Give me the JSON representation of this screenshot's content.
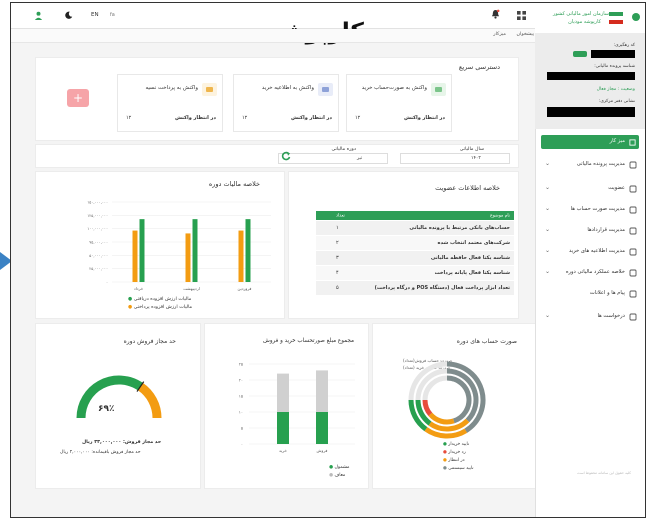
{
  "title_overlay": "کارپوشه",
  "header": {
    "lang": "EN",
    "lang_alt": "fa",
    "org_name": "سازمان امور مالیاتی کشور",
    "app_name": "کارپوشه مودیان"
  },
  "breadcrumb": {
    "item1": "پیشخوان",
    "item2": "میزکار"
  },
  "user": {
    "id_label": "کد رهگیری:",
    "id_value": "--",
    "file_label": "شناسه پرونده مالیاتی:",
    "status_label": "وضعیت : مجاز فعال",
    "office_label": "نشانی دفتر مرکزی:"
  },
  "sidebar": {
    "active": "میز کار",
    "items": [
      {
        "label": "مدیریت پرونده مالیاتی",
        "expand": true
      },
      {
        "label": "عضویت",
        "expand": true
      },
      {
        "label": "مدیریت صورت حساب ها",
        "expand": true
      },
      {
        "label": "مدیریت قراردادها",
        "expand": true
      },
      {
        "label": "مدیریت اطلاعیه های خرید",
        "expand": true
      },
      {
        "label": "خلاصه عملکرد مالیاتی دوره",
        "expand": true
      },
      {
        "label": "پیام ها و اعلانات",
        "expand": false
      },
      {
        "label": "درخواست ها",
        "expand": true
      }
    ],
    "footer": "کلیه حقوق این سامانه محفوظ است"
  },
  "quick_access": {
    "title": "دسترسی سریع",
    "cards": [
      {
        "title": "واکنش به صورت‌حساب خرید",
        "status": "در انتظار واکنش",
        "count": "۱۲",
        "accent": "#e7f5e9",
        "icon": "#7bc58a"
      },
      {
        "title": "واکنش به اطلاعیه خرید",
        "status": "در انتظار واکنش",
        "count": "۱۲",
        "accent": "#e8ecf8",
        "icon": "#8ea2d8"
      },
      {
        "title": "واکنش به پرداخت نسیه",
        "status": "در انتظار واکنش",
        "count": "۱۲",
        "accent": "#fdf3df",
        "icon": "#efb64d"
      }
    ],
    "add_button": "+"
  },
  "filters": {
    "year_label": "سال مالیاتی",
    "year_value": "۱۴۰۲",
    "period_label": "دوره مالیاتی",
    "period_value": "تیر"
  },
  "membership": {
    "title": "خلاصه اطلاعات عضویت",
    "col_name": "نام موضوع",
    "col_count": "تعداد",
    "rows": [
      {
        "name": "حساب‌های بانکی مرتبط با پرونده مالیاتی",
        "count": "۱"
      },
      {
        "name": "شرکت‌های معتمد انتخاب شده",
        "count": "۲"
      },
      {
        "name": "شناسه یکتا فعال حافظه مالیاتی",
        "count": "۳"
      },
      {
        "name": "شناسه یکتا فعال پایانه پرداخت",
        "count": "۴"
      },
      {
        "name": "تعداد ابزار پرداخت فعال (دستگاه POS و درگاه پرداخت)",
        "count": "۵"
      }
    ]
  },
  "tax_summary": {
    "title": "خلاصه مالیات دوره",
    "legend": [
      "مالیات ارزش افزوده دریافتی",
      "مالیات ارزش افزوده پرداختی"
    ],
    "colors": {
      "received": "#27a04f",
      "paid": "#f39c12"
    }
  },
  "sales_limit": {
    "title": "حد مجاز فروش دوره",
    "percent": "۶۹٪",
    "percent_value": 0.69,
    "limit_label": "حد مجاز فروش: ۳۳,۰۰۰,۰۰۰ ریال",
    "remain_label": "حد مجاز فروش باقیمانده: ۲,۰۰۰,۰۰۰ ریال"
  },
  "totals": {
    "title": "مجموع مبلغ صورتحساب خرید و فروش",
    "legend": [
      "مشمول",
      "معاف"
    ],
    "colors": {
      "subject": "#27a04f",
      "exempt": "#d0d0d0"
    }
  },
  "invoices": {
    "title": "صورت حساب های دوره",
    "legend": [
      "تایید خریدار",
      "رد خریدار",
      "در انتظار",
      "تایید سیستمی"
    ],
    "colors": [
      "#27a04f",
      "#e74c3c",
      "#f39c12",
      "#7f8c8d"
    ],
    "note1": "صورت حساب فروش(تعداد)",
    "note2": "صورت حساب خرید (تعداد)"
  },
  "chart_data": [
    {
      "type": "bar",
      "title": "خلاصه مالیات دوره",
      "categories": [
        "خرداد",
        "اردیبهشت",
        "فروردین"
      ],
      "series": [
        {
          "name": "مالیات ارزش افزوده دریافتی",
          "values": [
            1100000,
            1100000,
            1100000
          ]
        },
        {
          "name": "مالیات ارزش افزوده پرداختی",
          "values": [
            900000,
            850000,
            900000
          ]
        }
      ],
      "ylim": [
        0,
        1400000
      ],
      "ticks": [
        "۰",
        "۲۵,۰۰۰,۰۰۰",
        "۵۰,۰۰۰,۰۰۰",
        "۷۵,۰۰۰,۰۰۰",
        "۱۰۰,۰۰۰,۰۰۰",
        "۱۲۵,۰۰۰,۰۰۰",
        "۱۵۰,۰۰۰,۰۰۰"
      ]
    },
    {
      "type": "bar",
      "title": "مجموع مبلغ صورتحساب خرید و فروش",
      "categories": [
        "خرید",
        "فروش"
      ],
      "series": [
        {
          "name": "مشمول",
          "values": [
            10,
            10
          ]
        },
        {
          "name": "معاف",
          "values": [
            12,
            13
          ]
        }
      ],
      "ylim": [
        0,
        25
      ],
      "ticks": [
        "۰",
        "۵",
        "۱۰",
        "۱۵",
        "۲۰",
        "۲۵"
      ]
    }
  ]
}
